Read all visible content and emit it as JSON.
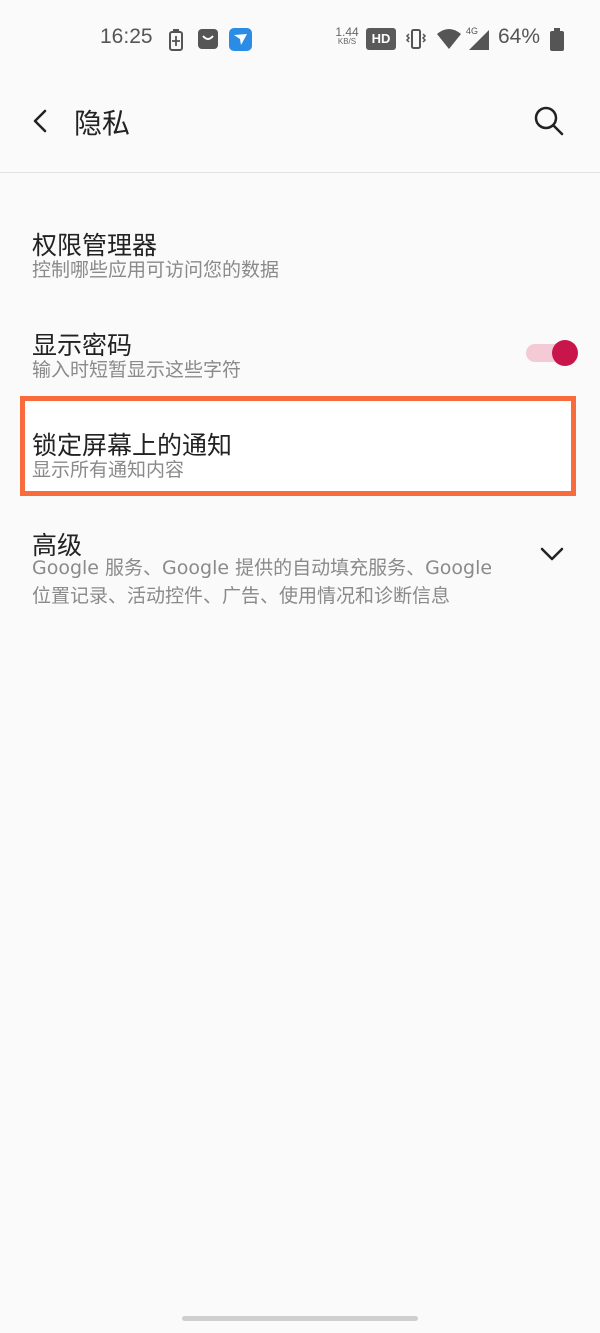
{
  "status_bar": {
    "time": "16:25",
    "speed_value": "1.44",
    "speed_unit": "KB/S",
    "hd": "HD",
    "network": "4G",
    "battery_percent": "64%"
  },
  "header": {
    "title": "隐私"
  },
  "items": [
    {
      "title": "权限管理器",
      "subtitle": "控制哪些应用可访问您的数据"
    },
    {
      "title": "显示密码",
      "subtitle": "输入时短暂显示这些字符",
      "toggle_on": true
    },
    {
      "title": "锁定屏幕上的通知",
      "subtitle": "显示所有通知内容",
      "highlighted": true
    },
    {
      "title": "高级",
      "subtitle_line1": "Google 服务、Google 提供的自动填充服务、Google",
      "subtitle_line2": "位置记录、活动控件、广告、使用情况和诊断信息"
    }
  ],
  "colors": {
    "accent": "#c8164a",
    "toggle_track": "#f3cad6",
    "highlight_border": "#f86b3d",
    "background": "#fafafa"
  },
  "icons": {
    "back": "back-arrow-icon",
    "search": "search-icon",
    "expand": "chevron-down-icon"
  }
}
